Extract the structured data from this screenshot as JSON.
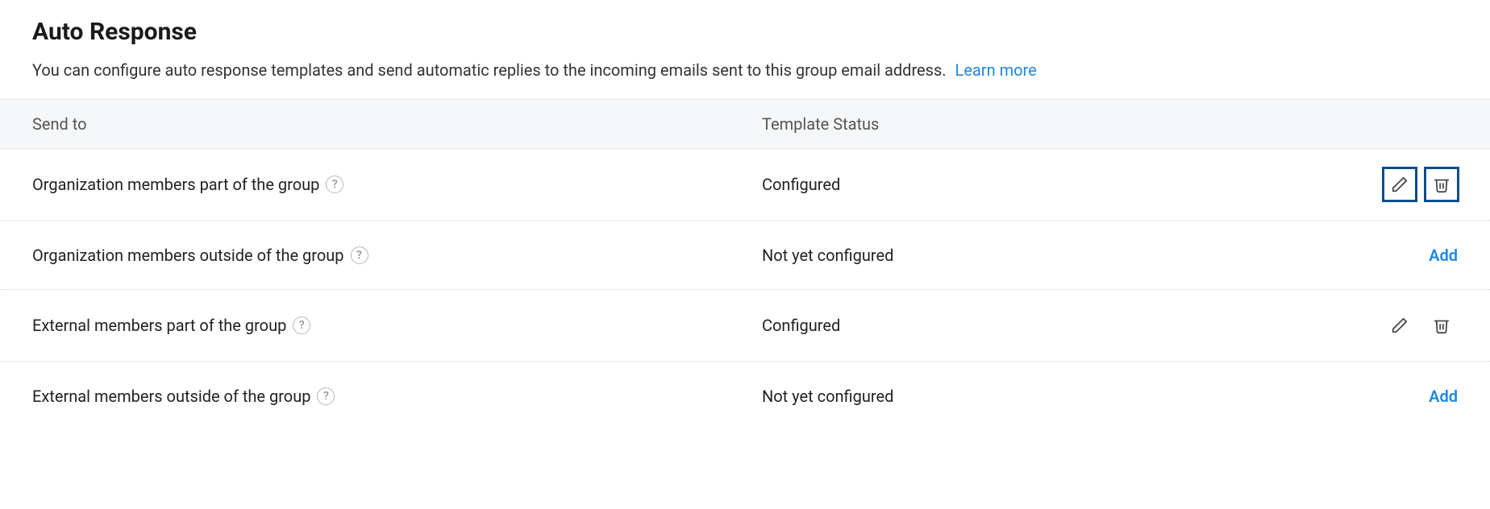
{
  "header": {
    "title": "Auto Response",
    "description": "You can configure auto response templates and send automatic replies to the incoming emails sent to this group email address.",
    "learn_more_label": "Learn more"
  },
  "table": {
    "columns": {
      "send_to": "Send to",
      "template_status": "Template Status"
    },
    "rows": [
      {
        "send_to": "Organization members part of the group",
        "status": "Configured",
        "has_help": true,
        "action_type": "edit_delete",
        "selected": true
      },
      {
        "send_to": "Organization members outside of the group",
        "status": "Not yet configured",
        "has_help": true,
        "action_type": "add",
        "selected": false
      },
      {
        "send_to": "External members part of the group",
        "status": "Configured",
        "has_help": true,
        "action_type": "edit_delete",
        "selected": false
      },
      {
        "send_to": "External members outside of the group",
        "status": "Not yet configured",
        "has_help": true,
        "action_type": "add",
        "selected": false
      }
    ],
    "add_label": "Add"
  },
  "icons": {
    "help_glyph": "?"
  }
}
